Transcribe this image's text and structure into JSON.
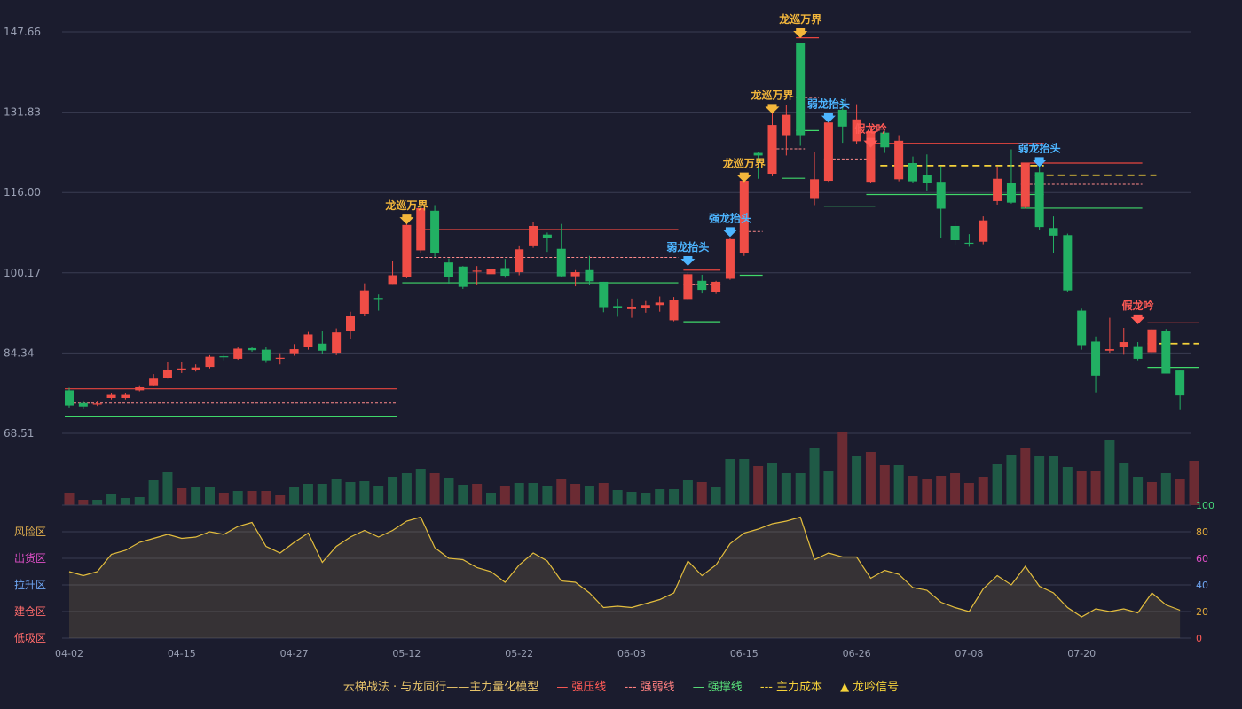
{
  "chart_data": {
    "type": "candlestick",
    "price_axis": {
      "ticks": [
        "147.66",
        "131.83",
        "116.00",
        "100.17",
        "84.34",
        "68.51"
      ],
      "min": 68.51,
      "max": 147.66
    },
    "x_ticks": [
      {
        "label": "04-02",
        "index": 0
      },
      {
        "label": "04-15",
        "index": 8
      },
      {
        "label": "04-27",
        "index": 16
      },
      {
        "label": "05-12",
        "index": 24
      },
      {
        "label": "05-22",
        "index": 32
      },
      {
        "label": "06-03",
        "index": 40
      },
      {
        "label": "06-15",
        "index": 48
      },
      {
        "label": "06-26",
        "index": 56
      },
      {
        "label": "07-08",
        "index": 64
      },
      {
        "label": "07-20",
        "index": 72
      }
    ],
    "candles": [
      [
        77,
        74,
        77.5,
        73.6
      ],
      [
        74.5,
        73.8,
        75,
        73.4
      ],
      [
        74.2,
        74.4,
        74.8,
        73.9
      ],
      [
        75.5,
        76.1,
        76.5,
        75.2
      ],
      [
        75.5,
        76.1,
        76.4,
        75.2
      ],
      [
        77,
        77.6,
        78,
        76.8
      ],
      [
        78,
        79.3,
        80.2,
        77.9
      ],
      [
        79.5,
        81,
        82.6,
        79.3
      ],
      [
        81,
        81.3,
        82.5,
        80.4
      ],
      [
        81,
        81.5,
        82.1,
        80.7
      ],
      [
        81.6,
        83.6,
        83.9,
        81.3
      ],
      [
        83.7,
        83.5,
        84,
        82.9
      ],
      [
        83.2,
        85.2,
        85.6,
        83
      ],
      [
        85.3,
        84.9,
        85.5,
        84.6
      ],
      [
        85,
        82.9,
        85.6,
        82.4
      ],
      [
        83.2,
        83.4,
        84.3,
        82.1
      ],
      [
        84.3,
        85.1,
        86.1,
        83.8
      ],
      [
        85.5,
        88,
        88.5,
        85
      ],
      [
        86.2,
        84.8,
        88.6,
        84.2
      ],
      [
        84.4,
        88.4,
        89.2,
        83.9
      ],
      [
        88.7,
        91.6,
        92.5,
        87.1
      ],
      [
        92.1,
        96.7,
        98.1,
        91.7
      ],
      [
        95.2,
        95,
        95.9,
        92.7
      ],
      [
        97.8,
        99.7,
        102.5,
        97.8
      ],
      [
        99.3,
        109.6,
        110,
        99.1
      ],
      [
        104.6,
        112.9,
        113.3,
        104
      ],
      [
        112.4,
        104,
        113.5,
        103.3
      ],
      [
        102.2,
        99.3,
        103,
        97.9
      ],
      [
        101.4,
        97.4,
        101.5,
        97
      ],
      [
        100.4,
        100.6,
        101.5,
        97.7
      ],
      [
        99.9,
        100.9,
        101.6,
        99.3
      ],
      [
        101.1,
        99.6,
        102.9,
        99.2
      ],
      [
        100.3,
        104.8,
        105.4,
        99.7
      ],
      [
        105.4,
        109.4,
        110.1,
        105.1
      ],
      [
        107.7,
        107.1,
        108.1,
        104.3
      ],
      [
        104.9,
        99.5,
        109.8,
        99.4
      ],
      [
        99.5,
        100.3,
        100.7,
        97.5
      ],
      [
        100.7,
        98.5,
        103.5,
        97.7
      ],
      [
        98.4,
        93.4,
        98.4,
        92.4
      ],
      [
        93.6,
        93.3,
        95.1,
        91.5
      ],
      [
        93,
        93.5,
        95.1,
        91.3
      ],
      [
        93.3,
        93.8,
        94.6,
        92.3
      ],
      [
        93.8,
        94.3,
        95.5,
        92.5
      ],
      [
        90.8,
        94.8,
        95.4,
        90.6
      ],
      [
        95,
        99.9,
        100.3,
        94.8
      ],
      [
        98.6,
        96.8,
        99.8,
        96.1
      ],
      [
        96.3,
        98.4,
        98.6,
        96
      ],
      [
        99,
        106.8,
        107.1,
        98.8
      ],
      [
        104,
        118.3,
        118.8,
        103.5
      ],
      [
        123.8,
        123.3,
        123.9,
        118.7
      ],
      [
        119.7,
        129.3,
        131.8,
        119.2
      ],
      [
        127.3,
        131.3,
        133.3,
        123.3
      ],
      [
        145.5,
        127.3,
        145.5,
        125.2
      ],
      [
        114.9,
        118.6,
        124,
        113.5
      ],
      [
        118.3,
        129.8,
        130.6,
        118.1
      ],
      [
        132.3,
        129,
        134.3,
        125.8
      ],
      [
        126.1,
        130.4,
        133.4,
        125.6
      ],
      [
        118.1,
        128.1,
        128.7,
        117.8
      ],
      [
        127.8,
        124.9,
        128.1,
        123.8
      ],
      [
        118.6,
        126.2,
        127.3,
        118.2
      ],
      [
        121.8,
        118.2,
        123.1,
        117.9
      ],
      [
        119.4,
        117.8,
        123.5,
        116.4
      ],
      [
        118.1,
        112.8,
        121.2,
        107.1
      ],
      [
        109.4,
        106.6,
        110.4,
        105.6
      ],
      [
        106.1,
        105.9,
        107.8,
        105.3
      ],
      [
        106.3,
        110.5,
        111.3,
        105.8
      ],
      [
        114.3,
        118.7,
        121.1,
        113.6
      ],
      [
        117.8,
        114,
        124.5,
        113.8
      ],
      [
        113.1,
        121.8,
        121.8,
        112.8
      ],
      [
        120,
        109.2,
        121.8,
        108.6
      ],
      [
        109,
        107.5,
        111.3,
        104.1
      ],
      [
        107.6,
        96.7,
        107.9,
        96.4
      ],
      [
        92.7,
        85.9,
        93.1,
        85
      ],
      [
        86.6,
        79.9,
        87.6,
        76.6
      ],
      [
        84.8,
        85.1,
        91.3,
        84.4
      ],
      [
        85.5,
        86.5,
        89.3,
        84
      ],
      [
        85.7,
        83.2,
        86.5,
        82.9
      ],
      [
        84.5,
        89,
        89.2,
        84
      ],
      [
        88.7,
        80.3,
        89.1,
        80.3
      ],
      [
        80.9,
        76,
        80.9,
        73.1
      ]
    ],
    "volume": [
      [
        14,
        "r"
      ],
      [
        6,
        "r"
      ],
      [
        6,
        "g"
      ],
      [
        13,
        "g"
      ],
      [
        8,
        "g"
      ],
      [
        9,
        "g"
      ],
      [
        28,
        "g"
      ],
      [
        37,
        "g"
      ],
      [
        19,
        "r"
      ],
      [
        20,
        "g"
      ],
      [
        21,
        "g"
      ],
      [
        14,
        "r"
      ],
      [
        16,
        "g"
      ],
      [
        16,
        "r"
      ],
      [
        16,
        "r"
      ],
      [
        11,
        "r"
      ],
      [
        21,
        "g"
      ],
      [
        24,
        "g"
      ],
      [
        24,
        "g"
      ],
      [
        29,
        "g"
      ],
      [
        26,
        "g"
      ],
      [
        27,
        "g"
      ],
      [
        22,
        "g"
      ],
      [
        32,
        "g"
      ],
      [
        36,
        "g"
      ],
      [
        41,
        "g"
      ],
      [
        36,
        "r"
      ],
      [
        31,
        "g"
      ],
      [
        23,
        "g"
      ],
      [
        24,
        "r"
      ],
      [
        14,
        "g"
      ],
      [
        22,
        "r"
      ],
      [
        25,
        "g"
      ],
      [
        25,
        "g"
      ],
      [
        22,
        "g"
      ],
      [
        30,
        "r"
      ],
      [
        24,
        "r"
      ],
      [
        22,
        "g"
      ],
      [
        25,
        "r"
      ],
      [
        17,
        "g"
      ],
      [
        15,
        "g"
      ],
      [
        14,
        "g"
      ],
      [
        18,
        "g"
      ],
      [
        18,
        "g"
      ],
      [
        28,
        "g"
      ],
      [
        26,
        "r"
      ],
      [
        20,
        "g"
      ],
      [
        52,
        "g"
      ],
      [
        52,
        "g"
      ],
      [
        44,
        "r"
      ],
      [
        48,
        "g"
      ],
      [
        36,
        "g"
      ],
      [
        36,
        "g"
      ],
      [
        65,
        "g"
      ],
      [
        38,
        "g"
      ],
      [
        82,
        "r"
      ],
      [
        55,
        "g"
      ],
      [
        60,
        "r"
      ],
      [
        45,
        "r"
      ],
      [
        45,
        "g"
      ],
      [
        33,
        "r"
      ],
      [
        30,
        "r"
      ],
      [
        33,
        "r"
      ],
      [
        36,
        "r"
      ],
      [
        25,
        "r"
      ],
      [
        32,
        "r"
      ],
      [
        46,
        "g"
      ],
      [
        57,
        "g"
      ],
      [
        65,
        "r"
      ],
      [
        55,
        "g"
      ],
      [
        55,
        "g"
      ],
      [
        43,
        "g"
      ],
      [
        38,
        "r"
      ],
      [
        38,
        "r"
      ],
      [
        74,
        "g"
      ],
      [
        48,
        "g"
      ],
      [
        32,
        "g"
      ],
      [
        26,
        "r"
      ],
      [
        36,
        "g"
      ],
      [
        30,
        "r"
      ],
      [
        50,
        "r"
      ]
    ],
    "osc": [
      50,
      47,
      50,
      63,
      66,
      72,
      75,
      78,
      75,
      76,
      80,
      78,
      84,
      87,
      69,
      64,
      72,
      79,
      57,
      69,
      76,
      81,
      76,
      81,
      88,
      91,
      68,
      60,
      59,
      53,
      50,
      42,
      55,
      64,
      58,
      43,
      42,
      34,
      23,
      24,
      23,
      26,
      29,
      34,
      58,
      47,
      55,
      71,
      79,
      82,
      86,
      88,
      91,
      59,
      64,
      61,
      61,
      45,
      51,
      48,
      38,
      36,
      27,
      23,
      20,
      37,
      47,
      40,
      54,
      39,
      34,
      23,
      16,
      22,
      20,
      22,
      19,
      34,
      25,
      21
    ],
    "osc_axis": {
      "right_ticks": [
        "100",
        "80",
        "60",
        "40",
        "20",
        "0"
      ],
      "zones": [
        {
          "label": "风险区",
          "value": 80,
          "color": "#e7b34f"
        },
        {
          "label": "出货区",
          "value": 60,
          "color": "#e04fc8"
        },
        {
          "label": "拉升区",
          "value": 40,
          "color": "#6ea5f2"
        },
        {
          "label": "建仓区",
          "value": 20,
          "color": "#ff6b6b"
        },
        {
          "label": "低吸区",
          "value": 0,
          "color": "#ff6b6b"
        }
      ]
    },
    "lines": [
      {
        "kind": "strong",
        "from": 0,
        "to": 23,
        "y": 77.3
      },
      {
        "kind": "weak",
        "from": 0,
        "to": 23,
        "y": 74.5
      },
      {
        "kind": "support",
        "from": 0,
        "to": 23,
        "y": 71.9
      },
      {
        "kind": "strong",
        "from": 25,
        "to": 43,
        "y": 108.7
      },
      {
        "kind": "weak",
        "from": 25,
        "to": 43,
        "y": 103.2
      },
      {
        "kind": "support",
        "from": 24,
        "to": 43,
        "y": 98.2
      },
      {
        "kind": "strong",
        "from": 44,
        "to": 46,
        "y": 100.7
      },
      {
        "kind": "weak",
        "from": 44,
        "to": 46,
        "y": 97.8
      },
      {
        "kind": "support",
        "from": 44,
        "to": 46,
        "y": 90.5
      },
      {
        "kind": "weak",
        "from": 48,
        "to": 49,
        "y": 108.3
      },
      {
        "kind": "support",
        "from": 48,
        "to": 49,
        "y": 99.7
      },
      {
        "kind": "support",
        "from": 51,
        "to": 52,
        "y": 118.8
      },
      {
        "kind": "weak",
        "from": 50,
        "to": 52,
        "y": 124.6
      },
      {
        "kind": "strong",
        "from": 52,
        "to": 53,
        "y": 146.5
      },
      {
        "kind": "weak",
        "from": 52,
        "to": 53,
        "y": 134.7
      },
      {
        "kind": "support",
        "from": 52,
        "to": 53,
        "y": 128.2
      },
      {
        "kind": "weak",
        "from": 54,
        "to": 57,
        "y": 122.6
      },
      {
        "kind": "support",
        "from": 54,
        "to": 57,
        "y": 113.3
      },
      {
        "kind": "strong",
        "from": 57,
        "to": 69,
        "y": 125.7
      },
      {
        "kind": "support",
        "from": 57,
        "to": 69,
        "y": 115.6
      },
      {
        "kind": "cost",
        "from": 58,
        "to": 69,
        "y": 121.3
      },
      {
        "kind": "strong",
        "from": 68,
        "to": 76,
        "y": 121.8
      },
      {
        "kind": "weak",
        "from": 68,
        "to": 76,
        "y": 117.6
      },
      {
        "kind": "support",
        "from": 68,
        "to": 76,
        "y": 112.9
      },
      {
        "kind": "cost",
        "from": 69,
        "to": 77,
        "y": 119.4
      },
      {
        "kind": "strong",
        "from": 77,
        "to": 80,
        "y": 90.3
      },
      {
        "kind": "cost",
        "from": 77,
        "to": 80,
        "y": 86.2
      },
      {
        "kind": "support",
        "from": 77,
        "to": 80,
        "y": 81.5
      }
    ],
    "signals": [
      {
        "index": 24,
        "label": "龙巡万界",
        "color": "#f4b73b",
        "y": 112.7
      },
      {
        "index": 44,
        "label": "弱龙抬头",
        "color": "#4db5ff",
        "y": 104.5
      },
      {
        "index": 47,
        "label": "强龙抬头",
        "color": "#4db5ff",
        "y": 110.2
      },
      {
        "index": 48,
        "label": "龙巡万界",
        "color": "#f4b73b",
        "y": 121
      },
      {
        "index": 50,
        "label": "龙巡万界",
        "color": "#f4b73b",
        "y": 134.5
      },
      {
        "index": 52,
        "label": "龙巡万界",
        "color": "#f4b73b",
        "y": 149.4
      },
      {
        "index": 54,
        "label": "弱龙抬头",
        "color": "#4db5ff",
        "y": 132.7
      },
      {
        "index": 57,
        "label": "假龙吟",
        "color": "#ff5a55",
        "y": 127.8
      },
      {
        "index": 69,
        "label": "弱龙抬头",
        "color": "#4db5ff",
        "y": 124
      },
      {
        "index": 76,
        "label": "假龙吟",
        "color": "#ff5a55",
        "y": 93
      }
    ]
  },
  "legend": {
    "title": "云梯战法 · 与龙同行——主力量化模型",
    "items": [
      {
        "symbol": "—",
        "label": "强压线"
      },
      {
        "symbol": "---",
        "label": "强弱线"
      },
      {
        "symbol": "—",
        "label": "强撑线"
      },
      {
        "symbol": "---",
        "label": "主力成本"
      },
      {
        "symbol": "▲",
        "label": "龙吟信号"
      }
    ]
  },
  "colors": {
    "up": "#ef4d46",
    "down": "#22b063",
    "vol_up": "#6b2b33",
    "vol_down": "#1f5a46",
    "strong": "#e8453f",
    "weak": "#ff8a8a",
    "support": "#40d86a",
    "cost": "#f5d23a",
    "osc": "#e3bd3d",
    "osc_fill": "rgba(198,168,92,0.16)"
  }
}
